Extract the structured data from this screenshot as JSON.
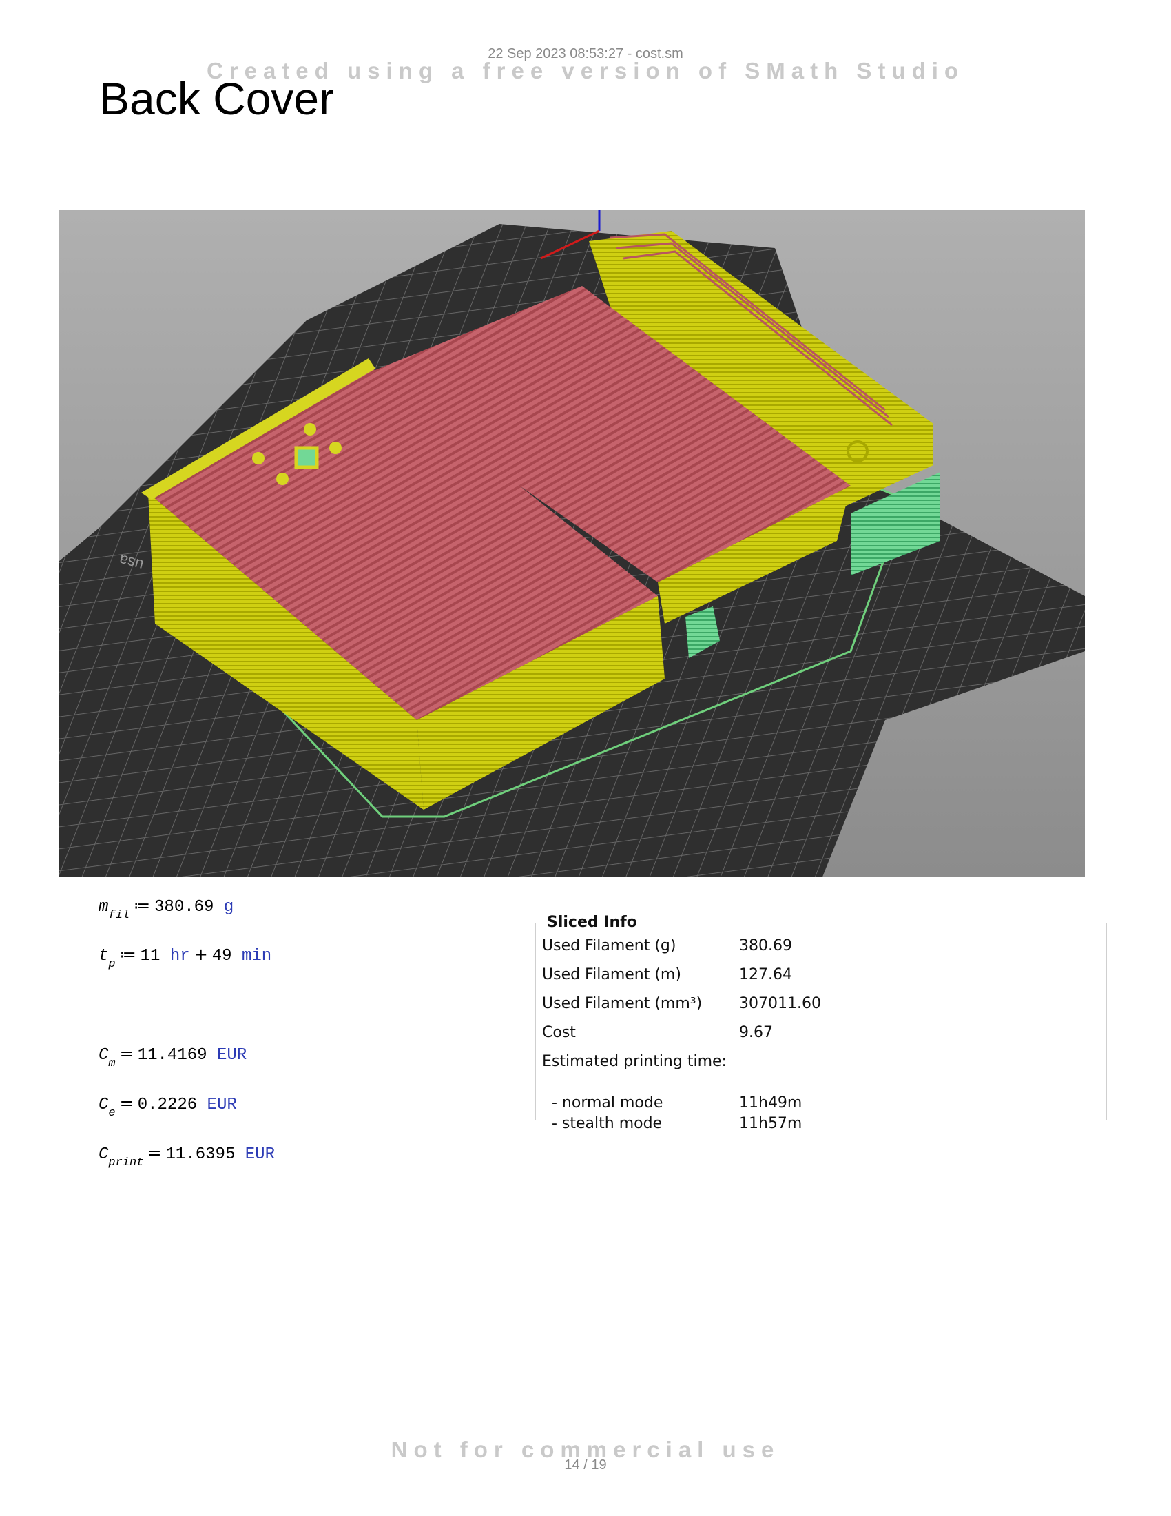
{
  "header": {
    "stamp": "22 Sep 2023 08:53:27 - cost.sm"
  },
  "watermarks": {
    "top": "Created using a free version of SMath Studio",
    "bottom": "Not for commercial use"
  },
  "title": "Back Cover",
  "image": {
    "bed_logo_text": "usa"
  },
  "math": {
    "m_fil": {
      "var": "m",
      "sub": "fil",
      "op": "≔",
      "value": "380.69",
      "unit": "g"
    },
    "t_p": {
      "var": "t",
      "sub": "p",
      "op": "≔",
      "hours": "11",
      "hours_unit": "hr",
      "plus": "+",
      "minutes": "49",
      "minutes_unit": "min"
    },
    "c_m": {
      "var": "C",
      "sub": "m",
      "op": "=",
      "value": "11.4169",
      "unit": "EUR"
    },
    "c_e": {
      "var": "C",
      "sub": "e",
      "op": "=",
      "value": "0.2226",
      "unit": "EUR"
    },
    "c_print": {
      "var": "C",
      "sub": "print",
      "op": "=",
      "value": "11.6395",
      "unit": "EUR"
    }
  },
  "sliced_info": {
    "title": "Sliced Info",
    "rows": [
      {
        "label": "Used Filament (g)",
        "value": "380.69"
      },
      {
        "label": "Used Filament (m)",
        "value": "127.64"
      },
      {
        "label": "Used Filament (mm³)",
        "value": "307011.60"
      },
      {
        "label": "Cost",
        "value": "9.67"
      },
      {
        "label": "Estimated printing time:",
        "value": ""
      },
      {
        "label": "  - normal mode",
        "value": "11h49m"
      },
      {
        "label": "  - stealth mode",
        "value": "11h57m"
      }
    ]
  },
  "footer": {
    "page": "14 / 19"
  },
  "colors": {
    "unit": "#2c3bb5",
    "perimeter": "#c8c800",
    "infill": "#c0606a",
    "support": "#5fd08a",
    "bed": "#333333"
  }
}
